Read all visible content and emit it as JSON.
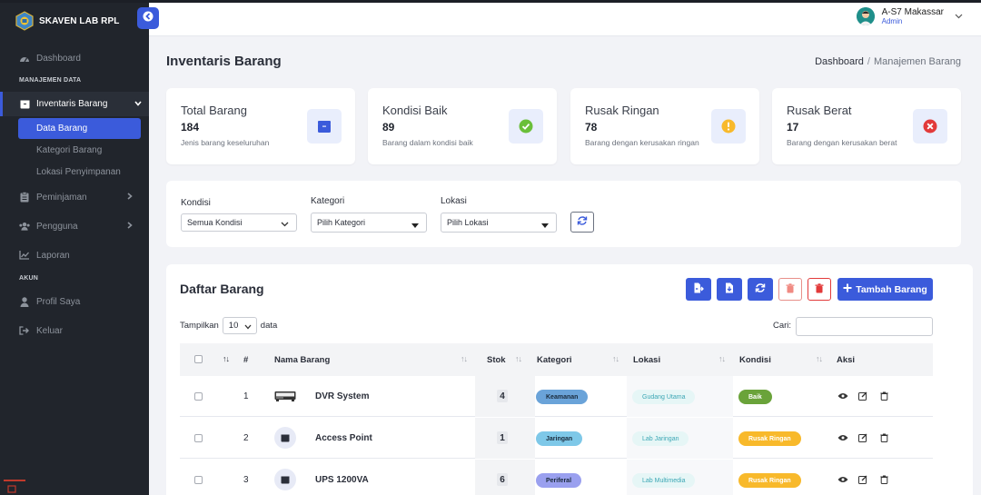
{
  "app": {
    "brand": "SKAVEN LAB RPL"
  },
  "colors": {
    "primary": "#3b5bdb",
    "sidebar": "#21252c",
    "success": "#6abf3a",
    "warning": "#f8b92b",
    "danger": "#e23a3a",
    "muted": "#6c727d"
  },
  "sidebar": {
    "dashboard": "Dashboard",
    "section_data": "MANAJEMEN DATA",
    "inventaris": "Inventaris Barang",
    "sub_items": [
      "Data Barang",
      "Kategori Barang",
      "Lokasi Penyimpanan"
    ],
    "peminjaman": "Peminjaman",
    "pengguna": "Pengguna",
    "laporan": "Laporan",
    "section_akun": "AKUN",
    "profil": "Profil Saya",
    "keluar": "Keluar"
  },
  "header": {
    "user_name": "A-S7 Makassar",
    "user_role": "Admin"
  },
  "page": {
    "title": "Inventaris Barang",
    "breadcrumb_home": "Dashboard",
    "breadcrumb_sep": "/",
    "breadcrumb_current": "Manajemen Barang"
  },
  "stats": [
    {
      "title": "Total Barang",
      "value": "184",
      "desc": "Jenis barang keseluruhan",
      "icon": "box-icon"
    },
    {
      "title": "Kondisi Baik",
      "value": "89",
      "desc": "Barang dalam kondisi baik",
      "icon": "check-circle-icon"
    },
    {
      "title": "Rusak Ringan",
      "value": "78",
      "desc": "Barang dengan kerusakan ringan",
      "icon": "warning-circle-icon"
    },
    {
      "title": "Rusak Berat",
      "value": "17",
      "desc": "Barang dengan kerusakan berat",
      "icon": "x-circle-icon"
    }
  ],
  "filters": {
    "kondisi_label": "Kondisi",
    "kondisi_value": "Semua Kondisi",
    "kategori_label": "Kategori",
    "kategori_value": "Pilih Kategori",
    "lokasi_label": "Lokasi",
    "lokasi_value": "Pilih Lokasi"
  },
  "list": {
    "title": "Daftar Barang",
    "add_label": "Tambah Barang",
    "show_label": "Tampilkan",
    "show_value": "10",
    "show_suffix": "data",
    "search_label": "Cari:",
    "columns": {
      "no": "#",
      "nama": "Nama Barang",
      "stok": "Stok",
      "kategori": "Kategori",
      "lokasi": "Lokasi",
      "kondisi": "Kondisi",
      "aksi": "Aksi"
    },
    "rows": [
      {
        "no": "1",
        "nama": "DVR System",
        "stok": "4",
        "kategori": "Keamanan",
        "lokasi": "Gudang Utama",
        "kondisi": "Baik"
      },
      {
        "no": "2",
        "nama": "Access Point",
        "stok": "1",
        "kategori": "Jaringan",
        "lokasi": "Lab Jaringan",
        "kondisi": "Rusak Ringan"
      },
      {
        "no": "3",
        "nama": "UPS 1200VA",
        "stok": "6",
        "kategori": "Periferal",
        "lokasi": "Lab Multimedia",
        "kondisi": "Rusak Ringan"
      }
    ]
  }
}
